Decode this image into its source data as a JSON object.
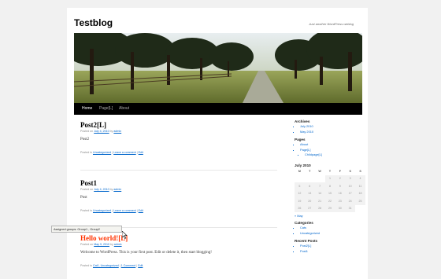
{
  "site": {
    "title": "Testblog",
    "description": "Just another WordPress weblog"
  },
  "nav": [
    {
      "label": "Home",
      "current": true
    },
    {
      "label": "Page[L]",
      "current": false
    },
    {
      "label": "About",
      "current": false
    }
  ],
  "posts": [
    {
      "title": "Post2[L]",
      "meta": {
        "prefix": "Posted on",
        "date": "July 4, 2010",
        "by": "by",
        "author": "admin"
      },
      "content": "Post2",
      "utility": {
        "posted_in": "Posted in",
        "category": "Uncategorized",
        "sep1": "|",
        "comment": "Leave a comment",
        "sep2": "|",
        "edit": "Edit"
      }
    },
    {
      "title": "Post1",
      "meta": {
        "prefix": "Posted on",
        "date": "July 4, 2010",
        "by": "by",
        "author": "admin"
      },
      "content": "Post",
      "utility": {
        "posted_in": "Posted in",
        "category": "Uncategorized",
        "sep1": "|",
        "comment": "Leave a comment",
        "sep2": "|",
        "edit": "Edit"
      }
    },
    {
      "title": "Hello world![L]",
      "meta": {
        "prefix": "Posted on",
        "date": "May 9, 2010",
        "by": "by",
        "author": "admin"
      },
      "content": "Welcome to WordPress. This is your first post. Edit or delete it, then start blogging!",
      "utility": {
        "posted_in": "Posted in",
        "category": "Cat1, Uncategorized",
        "sep1": "|",
        "comment": "1 Comment",
        "sep2": "|",
        "edit": "Edit"
      }
    }
  ],
  "tooltip": "Assigned groups: Group1 , Group2",
  "sidebar": {
    "archives": {
      "title": "Archives",
      "items": [
        "July 2010",
        "May 2010"
      ]
    },
    "pages": {
      "title": "Pages",
      "items": [
        "About",
        "Page[L]"
      ],
      "children": [
        "Childpage[L]"
      ]
    },
    "calendar": {
      "title": "July 2010",
      "headers": [
        "M",
        "T",
        "W",
        "T",
        "F",
        "S",
        "S"
      ],
      "rows": [
        [
          "",
          "",
          "",
          "1",
          "2",
          "3",
          "4"
        ],
        [
          "5",
          "6",
          "7",
          "8",
          "9",
          "10",
          "11"
        ],
        [
          "12",
          "13",
          "14",
          "15",
          "16",
          "17",
          "18"
        ],
        [
          "19",
          "20",
          "21",
          "22",
          "23",
          "24",
          "25"
        ],
        [
          "26",
          "27",
          "28",
          "29",
          "30",
          "31",
          ""
        ]
      ],
      "prev": "« May"
    },
    "categories": {
      "title": "Categories",
      "items": [
        "Cats",
        "Uncategorized"
      ]
    },
    "recent": {
      "title": "Recent Posts",
      "items": [
        "Post2[L]",
        "Post1"
      ]
    }
  }
}
